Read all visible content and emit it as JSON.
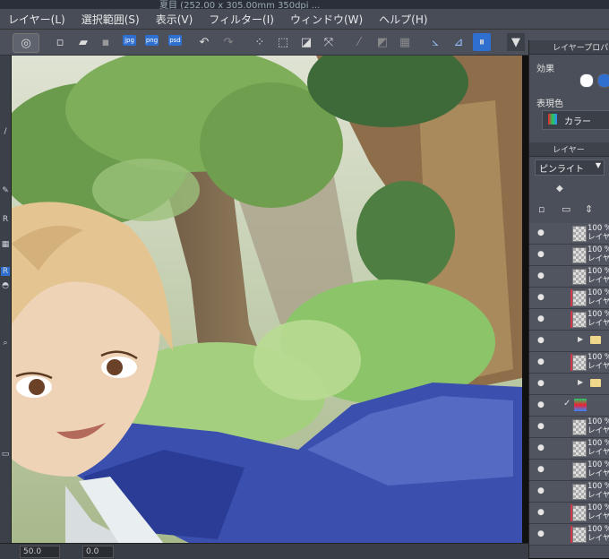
{
  "window": {
    "title": "夏目 (252.00 x 305.00mm 350dpi ..."
  },
  "menu": [
    "レイヤー(L)",
    "選択範囲(S)",
    "表示(V)",
    "フィルター(I)",
    "ウィンドウ(W)",
    "ヘルプ(H)"
  ],
  "toolbar": {
    "jpg": "jpg",
    "png": "png",
    "psd": "psd"
  },
  "properties_panel": {
    "title": "レイヤープロパティ",
    "effect_label": "効果",
    "expression_label": "表現色",
    "expression_value": "カラー"
  },
  "layer_panel": {
    "title": "レイヤー",
    "blend_mode": "ピンライト",
    "layers": [
      {
        "percent": "100 %",
        "name": "レイヤー",
        "type": "raster",
        "marked": false
      },
      {
        "percent": "100 %",
        "name": "レイヤー",
        "type": "raster",
        "marked": false
      },
      {
        "percent": "100 %",
        "name": "レイヤー",
        "type": "raster",
        "marked": false
      },
      {
        "percent": "100 %",
        "name": "レイヤー",
        "type": "raster",
        "marked": true
      },
      {
        "percent": "100 %",
        "name": "レイヤー",
        "type": "raster",
        "marked": true
      },
      {
        "percent": "",
        "name": "",
        "type": "folder",
        "marked": false
      },
      {
        "percent": "100 %",
        "name": "レイヤー",
        "type": "raster",
        "marked": true
      },
      {
        "percent": "",
        "name": "",
        "type": "folder",
        "marked": false
      },
      {
        "percent": "",
        "name": "",
        "type": "special",
        "marked": false
      },
      {
        "percent": "100 %",
        "name": "レイヤー",
        "type": "raster",
        "marked": false
      },
      {
        "percent": "100 %",
        "name": "レイヤー",
        "type": "raster",
        "marked": false
      },
      {
        "percent": "100 %",
        "name": "レイヤー",
        "type": "raster",
        "marked": false
      },
      {
        "percent": "100 %",
        "name": "レイヤー",
        "type": "raster",
        "marked": false
      },
      {
        "percent": "100 %",
        "name": "レイヤー",
        "type": "raster",
        "marked": true
      },
      {
        "percent": "100 %",
        "name": "レイヤー",
        "type": "raster",
        "marked": true
      }
    ]
  },
  "status": {
    "zoom": "50.0",
    "angle": "0.0"
  }
}
